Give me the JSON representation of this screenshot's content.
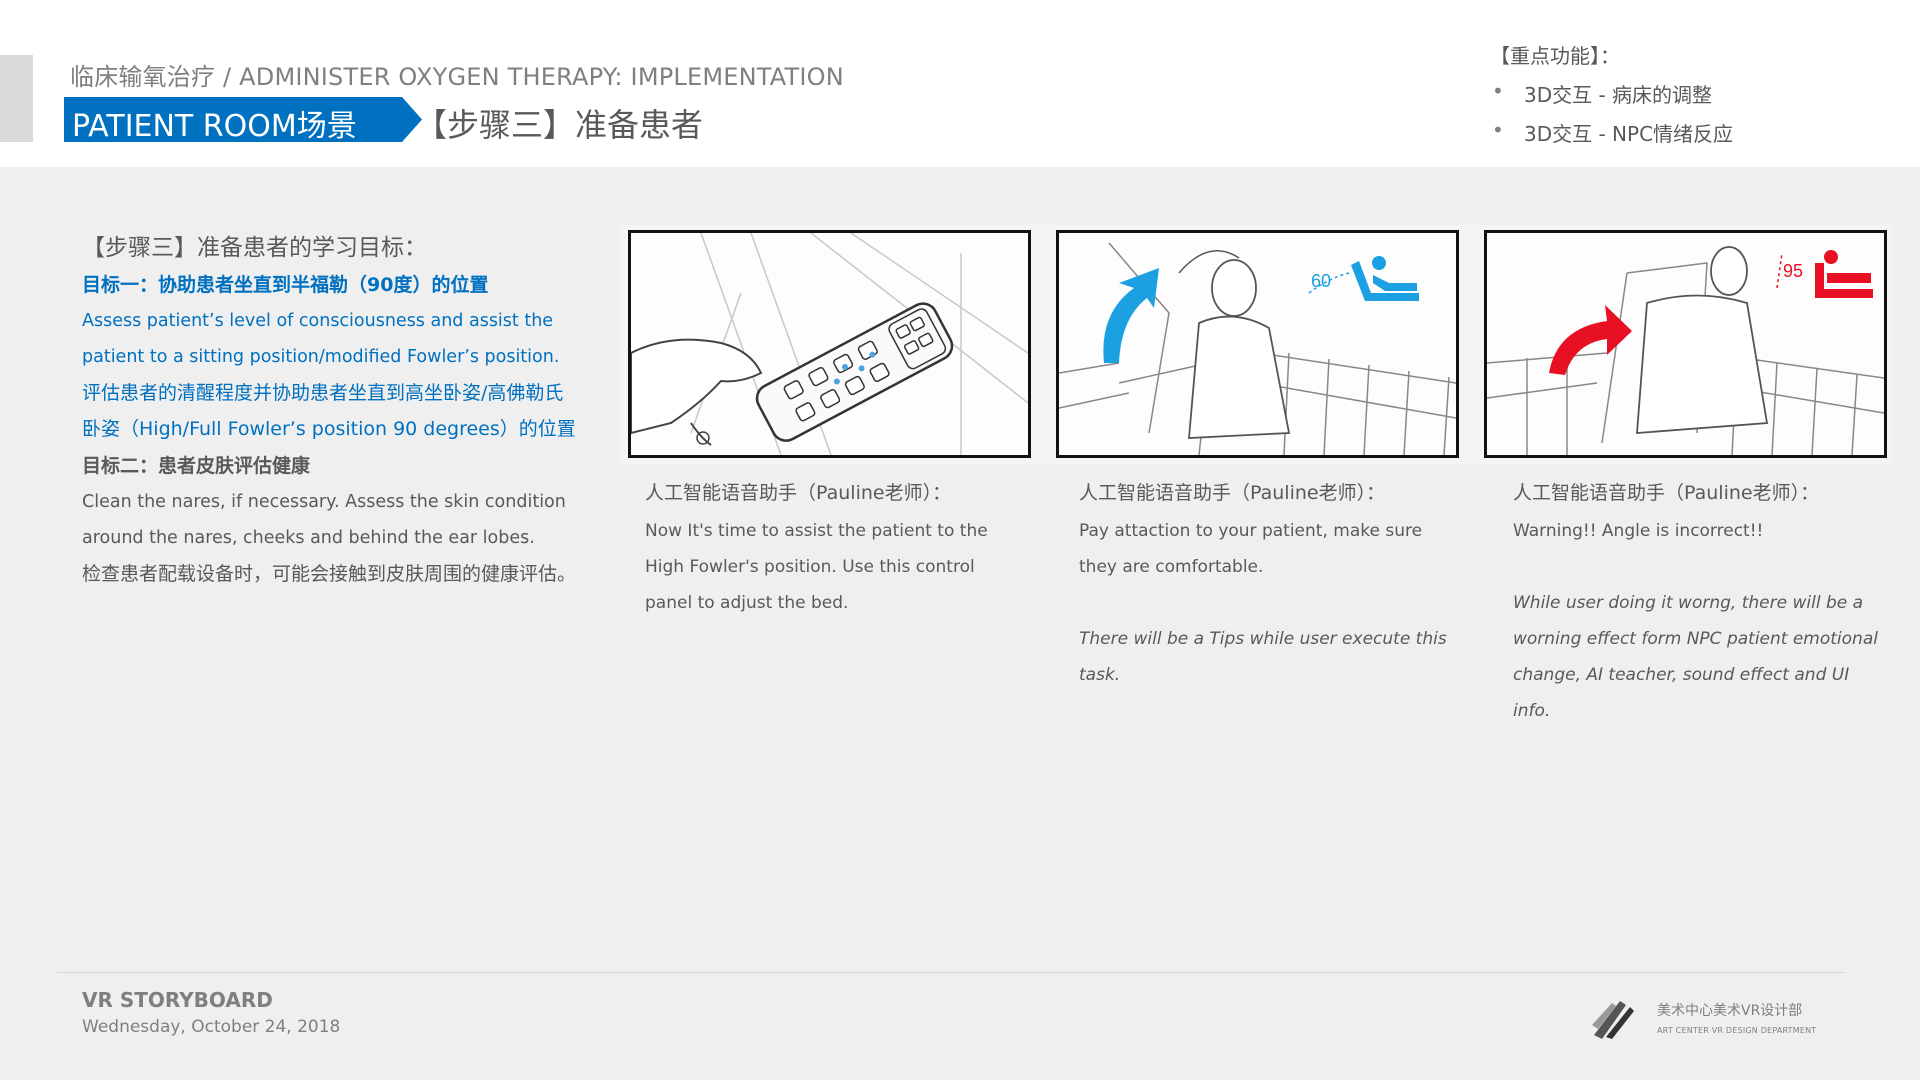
{
  "header": {
    "breadcrumb": "临床输氧治疗 / ADMINISTER  OXYGEN THERAPY: IMPLEMENTATION",
    "scene_tag": "PATIENT ROOM场景",
    "step_title": "【步骤三】准备患者",
    "scene_tag_color": "#0070c0"
  },
  "features": {
    "title": "【重点功能】：",
    "items": [
      "3D交互 - 病床的调整",
      "3D交互 - NPC情绪反应"
    ]
  },
  "objectives": {
    "heading": "【步骤三】准备患者的学习目标：",
    "goal1_title": "目标一：协助患者坐直到半福勒（90度）的位置",
    "goal1_en": "Assess patient’s level of consciousness and assist the patient to a sitting position/modified Fowler’s position.",
    "goal1_cn": "评估患者的清醒程度并协助患者坐直到高坐卧姿/高佛勒氏卧姿（High/Full Fowler’s position 90 degrees）的位置",
    "goal2_title": "目标二：患者皮肤评估健康",
    "goal2_en": "Clean the nares, if necessary. Assess the skin condition around the nares, cheeks and behind the ear lobes.",
    "goal2_cn": "检查患者配载设备时，可能会接触到皮肤周围的健康评估。"
  },
  "panels": [
    {
      "title": "人工智能语音助手（Pauline老师）：",
      "text": "Now It's time to assist the patient to the High Fowler's position. Use this control panel to adjust the bed.",
      "note": ""
    },
    {
      "title": "人工智能语音助手（Pauline老师）：",
      "text": "Pay attaction to your patient, make sure they are comfortable.",
      "note": "There will be a Tips while user execute this task.",
      "angle": "60",
      "accent": "#1ba1e2"
    },
    {
      "title": "人工智能语音助手（Pauline老师）：",
      "text": "Warning!! Angle is incorrect!!",
      "note": "While user doing it worng, there will be a worning effect form NPC patient emotional change, AI teacher, sound effect and UI info.",
      "angle": "95",
      "accent": "#e81123"
    }
  ],
  "footer": {
    "title": "VR STORYBOARD",
    "date": "Wednesday, October 24, 2018",
    "dept_cn": "美术中心美术VR设计部",
    "dept_en": "ART CENTER VR DESIGN DEPARTMENT"
  }
}
